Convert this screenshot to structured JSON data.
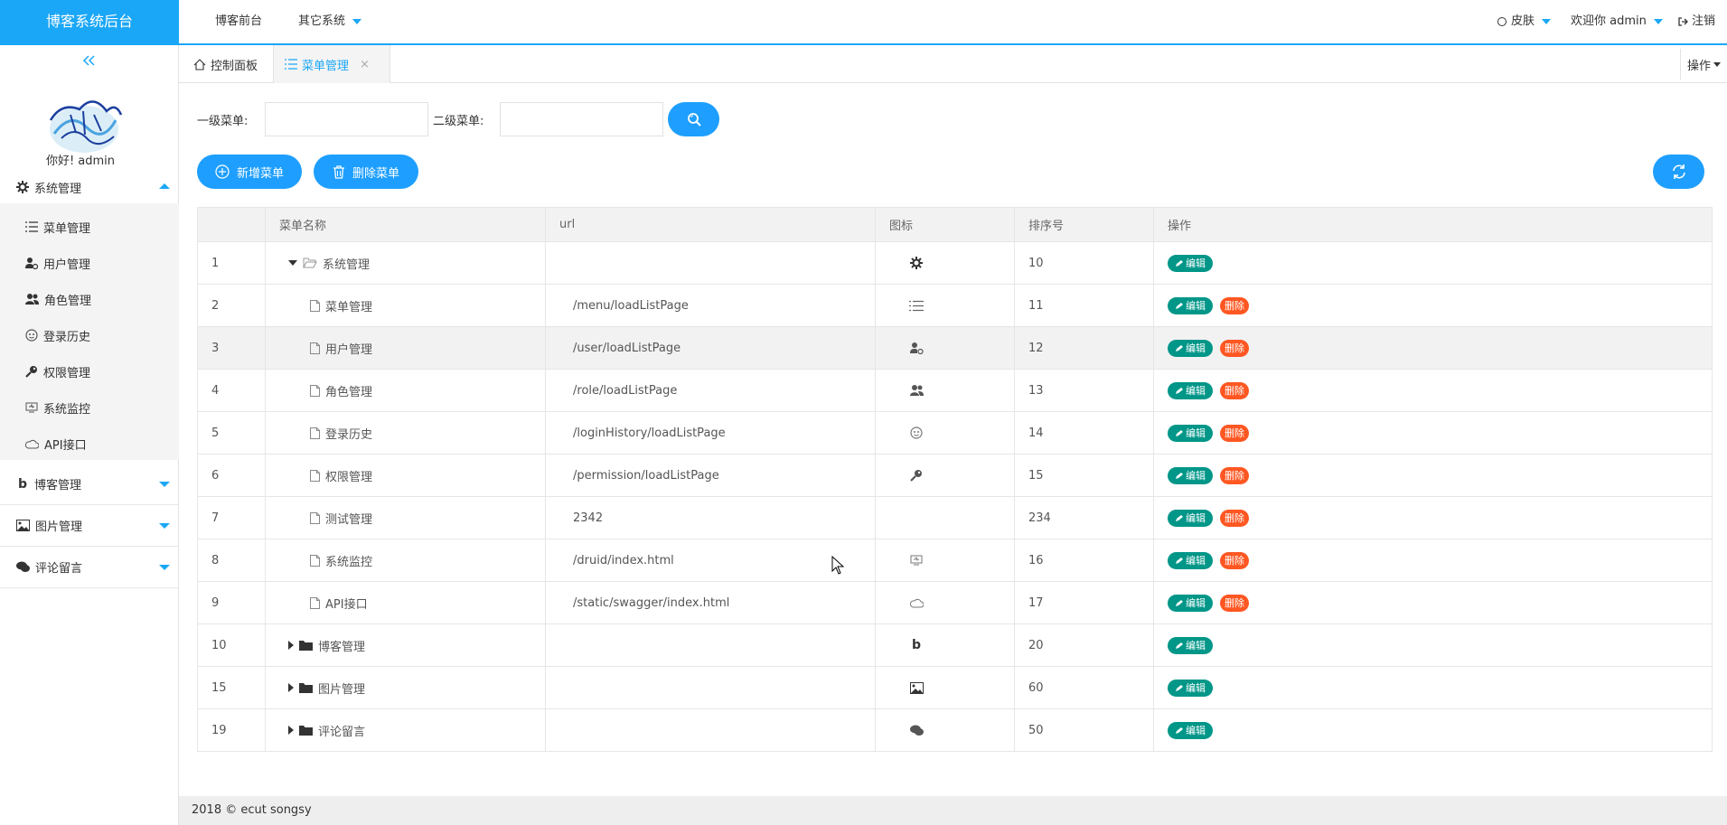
{
  "app": {
    "title": "博客系统后台"
  },
  "topnav": {
    "front": "博客前台",
    "other": "其它系统",
    "skin": "皮肤",
    "welcome": "欢迎你 admin",
    "logout": "注销"
  },
  "sidebar": {
    "greeting": "你好! admin",
    "groups": [
      {
        "label": "系统管理",
        "icon": "gear-icon",
        "expanded": true
      },
      {
        "label": "博客管理",
        "icon": "blog-b-icon",
        "expanded": false
      },
      {
        "label": "图片管理",
        "icon": "image-icon",
        "expanded": false
      },
      {
        "label": "评论留言",
        "icon": "comments-icon",
        "expanded": false
      }
    ],
    "items": [
      {
        "label": "菜单管理",
        "icon": "list-icon"
      },
      {
        "label": "用户管理",
        "icon": "user-gear-icon"
      },
      {
        "label": "角色管理",
        "icon": "users-icon"
      },
      {
        "label": "登录历史",
        "icon": "face-icon"
      },
      {
        "label": "权限管理",
        "icon": "key-icon"
      },
      {
        "label": "系统监控",
        "icon": "monitor-icon"
      },
      {
        "label": "API接口",
        "icon": "cloud-icon"
      }
    ]
  },
  "tabs": [
    {
      "label": "控制面板",
      "icon": "home-icon",
      "active": false
    },
    {
      "label": "菜单管理",
      "icon": "list-icon",
      "active": true,
      "close": "×"
    }
  ],
  "tab_ops": "操作",
  "filters": {
    "level1_label": "一级菜单:",
    "level2_label": "二级菜单:",
    "level1_value": "",
    "level2_value": ""
  },
  "actions": {
    "add": "新增菜单",
    "delete": "删除菜单"
  },
  "colors": {
    "brand": "#1ba7f7",
    "button": "#1e9fff",
    "edit": "#009688",
    "delete": "#ff5722"
  },
  "table": {
    "headers": [
      "",
      "菜单名称",
      "url",
      "图标",
      "排序号",
      "操作"
    ],
    "edit_label": "编辑",
    "delete_label": "删除",
    "rows": [
      {
        "id": "1",
        "name": "系统管理",
        "level": 0,
        "expand": "down",
        "node_icon": "folder-open-icon",
        "url": "",
        "icon": "gear-icon",
        "sort": "10",
        "deletable": false
      },
      {
        "id": "2",
        "name": "菜单管理",
        "level": 1,
        "expand": "none",
        "node_icon": "file-icon",
        "url": "/menu/loadListPage",
        "icon": "list-icon",
        "sort": "11",
        "deletable": true
      },
      {
        "id": "3",
        "name": "用户管理",
        "level": 1,
        "expand": "none",
        "node_icon": "file-icon",
        "url": "/user/loadListPage",
        "icon": "user-gear-icon",
        "sort": "12",
        "deletable": true,
        "highlight": true
      },
      {
        "id": "4",
        "name": "角色管理",
        "level": 1,
        "expand": "none",
        "node_icon": "file-icon",
        "url": "/role/loadListPage",
        "icon": "users-icon",
        "sort": "13",
        "deletable": true
      },
      {
        "id": "5",
        "name": "登录历史",
        "level": 1,
        "expand": "none",
        "node_icon": "file-icon",
        "url": "/loginHistory/loadListPage",
        "icon": "face-icon",
        "sort": "14",
        "deletable": true
      },
      {
        "id": "6",
        "name": "权限管理",
        "level": 1,
        "expand": "none",
        "node_icon": "file-icon",
        "url": "/permission/loadListPage",
        "icon": "key-icon",
        "sort": "15",
        "deletable": true
      },
      {
        "id": "7",
        "name": "测试管理",
        "level": 1,
        "expand": "none",
        "node_icon": "file-icon",
        "url": "2342",
        "icon": "",
        "sort": "234",
        "deletable": true
      },
      {
        "id": "8",
        "name": "系统监控",
        "level": 1,
        "expand": "none",
        "node_icon": "file-icon",
        "url": "/druid/index.html",
        "icon": "monitor-icon",
        "sort": "16",
        "deletable": true
      },
      {
        "id": "9",
        "name": "API接口",
        "level": 1,
        "expand": "none",
        "node_icon": "file-icon",
        "url": "/static/swagger/index.html",
        "icon": "cloud-icon",
        "sort": "17",
        "deletable": true
      },
      {
        "id": "10",
        "name": "博客管理",
        "level": 0,
        "expand": "right",
        "node_icon": "folder-icon",
        "url": "",
        "icon": "blog-b-icon",
        "sort": "20",
        "deletable": false
      },
      {
        "id": "15",
        "name": "图片管理",
        "level": 0,
        "expand": "right",
        "node_icon": "folder-icon",
        "url": "",
        "icon": "image-icon",
        "sort": "60",
        "deletable": false
      },
      {
        "id": "19",
        "name": "评论留言",
        "level": 0,
        "expand": "right",
        "node_icon": "folder-icon",
        "url": "",
        "icon": "comments-icon",
        "sort": "50",
        "deletable": false
      }
    ]
  },
  "footer": {
    "text": "2018 © ecut songsy"
  }
}
